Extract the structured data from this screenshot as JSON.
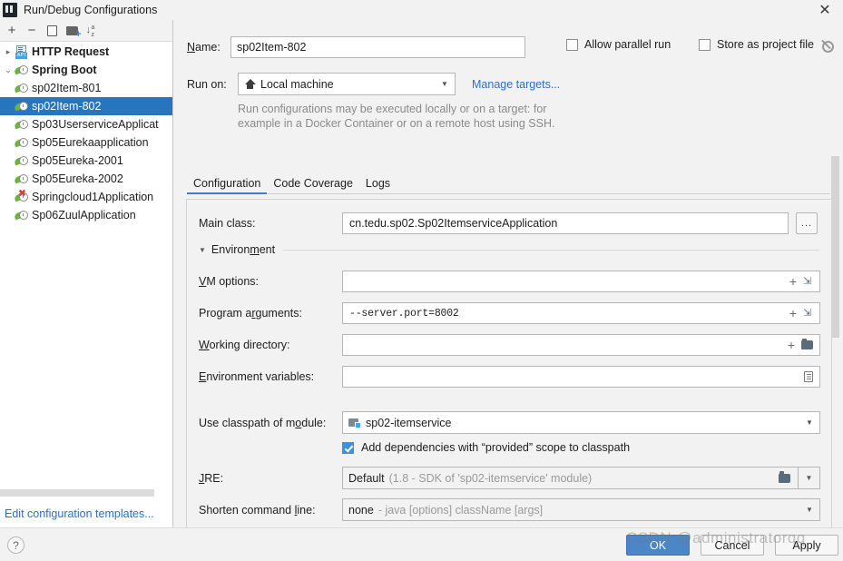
{
  "window": {
    "title": "Run/Debug Configurations",
    "app_icon": "intellij-idea-icon",
    "close_label": "✕"
  },
  "sidebar": {
    "toolbar": [
      {
        "name": "add-configuration-button",
        "glyph": "+"
      },
      {
        "name": "remove-configuration-button",
        "glyph": "−"
      },
      {
        "name": "copy-configuration-button",
        "glyph": "copy-icon"
      },
      {
        "name": "add-folder-button",
        "glyph": "folder-plus-icon"
      },
      {
        "name": "sort-configurations-button",
        "glyph": "sort-az-icon"
      }
    ],
    "tree": [
      {
        "label": "HTTP Request",
        "icon": "http-request-icon",
        "type": "group",
        "expandable": true,
        "expanded": false,
        "selected": false
      },
      {
        "label": "Spring Boot",
        "icon": "spring-boot-icon",
        "type": "group",
        "expandable": true,
        "expanded": true,
        "selected": false
      },
      {
        "label": "sp02Item-801",
        "icon": "spring-boot-config-icon",
        "type": "leaf",
        "selected": false
      },
      {
        "label": "sp02Item-802",
        "icon": "spring-boot-config-icon",
        "type": "leaf",
        "selected": true
      },
      {
        "label": "Sp03UserserviceApplicat",
        "icon": "spring-boot-config-icon",
        "type": "leaf",
        "selected": false
      },
      {
        "label": "Sp05Eurekaapplication",
        "icon": "spring-boot-config-icon",
        "type": "leaf",
        "selected": false
      },
      {
        "label": "Sp05Eureka-2001",
        "icon": "spring-boot-config-icon",
        "type": "leaf",
        "selected": false
      },
      {
        "label": "Sp05Eureka-2002",
        "icon": "spring-boot-config-icon",
        "type": "leaf",
        "selected": false
      },
      {
        "label": "Springcloud1Application",
        "icon": "spring-boot-config-error-icon",
        "type": "leaf",
        "selected": false,
        "error": true
      },
      {
        "label": "Sp06ZuulApplication",
        "icon": "spring-boot-config-icon",
        "type": "leaf",
        "selected": false
      }
    ],
    "edit_templates_link": "Edit configuration templates..."
  },
  "form": {
    "name_label": "Name:",
    "name_value": "sp02Item-802",
    "allow_parallel_run_label": "Allow parallel run",
    "allow_parallel_run_checked": false,
    "store_as_project_file_label": "Store as project file",
    "store_as_project_file_checked": false,
    "store_settings_icon": "gear-icon",
    "run_on_label": "Run on:",
    "run_on_value": "Local machine",
    "run_on_icon": "home-icon",
    "manage_targets_link": "Manage targets...",
    "hint_line_1": "Run configurations may be executed locally or on a target: for",
    "hint_line_2": "example in a Docker Container or on a remote host using SSH."
  },
  "tabs": [
    {
      "label": "Configuration",
      "active": true
    },
    {
      "label": "Code Coverage",
      "active": false
    },
    {
      "label": "Logs",
      "active": false
    }
  ],
  "configuration": {
    "main_class_label": "Main class:",
    "main_class_value": "cn.tedu.sp02.Sp02ItemserviceApplication",
    "main_class_browse_label": "...",
    "environment_section_label": "Environment",
    "environment_expanded": true,
    "vm_options_label": "VM options:",
    "vm_options_value": "",
    "program_arguments_label": "Program arguments:",
    "program_arguments_value": "--server.port=8002",
    "working_directory_label": "Working directory:",
    "working_directory_value": "",
    "environment_variables_label": "Environment variables:",
    "environment_variables_value": "",
    "use_classpath_label": "Use classpath of module:",
    "use_classpath_value": "sp02-itemservice",
    "use_classpath_icon": "module-icon",
    "add_provided_label": "Add dependencies with “provided” scope to classpath",
    "add_provided_checked": true,
    "jre_label": "JRE:",
    "jre_value_strong": "Default",
    "jre_value_dim": "(1.8 - SDK of 'sp02-itemservice' module)",
    "shorten_label": "Shorten command line:",
    "shorten_value_strong": "none",
    "shorten_value_dim": "- java [options] className [args]"
  },
  "footer": {
    "help_label": "?",
    "ok_label": "OK",
    "cancel_label": "Cancel",
    "apply_label": "Apply"
  },
  "watermark": "CSDN @administratorqq",
  "colors": {
    "accent": "#2675bf",
    "link": "#2a6fc9",
    "primary_button": "#4a86c8",
    "checkbox_checked": "#3c92db",
    "tab_underline": "#3b7dd8",
    "spring_green": "#6db33f",
    "error_red": "#e53935",
    "panel_bg": "#f2f2f2",
    "field_bg": "#ffffff"
  }
}
